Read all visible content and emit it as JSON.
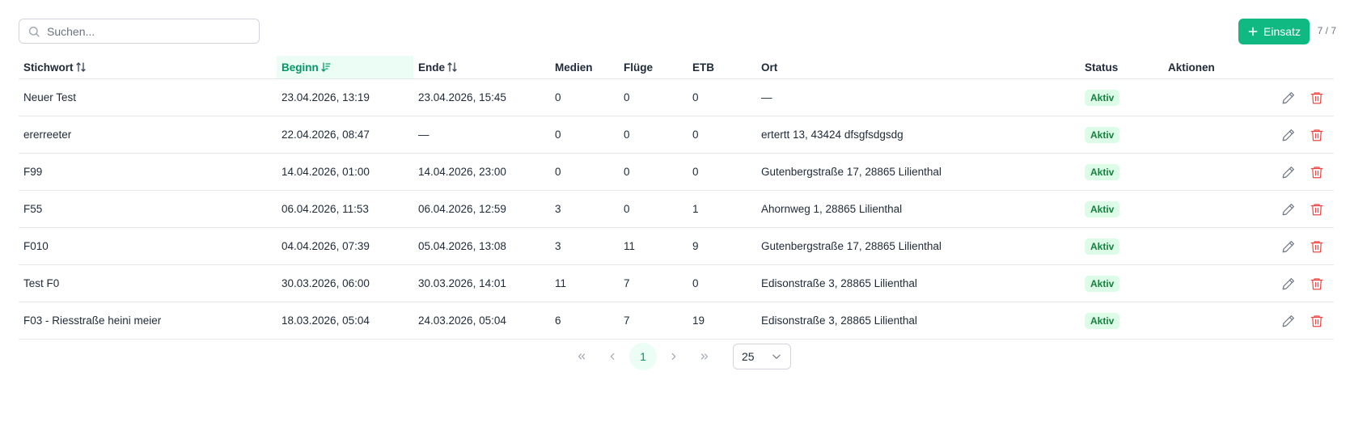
{
  "search": {
    "placeholder": "Suchen...",
    "value": ""
  },
  "toolbar": {
    "add_label": "Einsatz",
    "count": "7 / 7"
  },
  "colors": {
    "accent": "#10b981",
    "active_badge_bg": "#dcfce7",
    "active_badge_text": "#15803d",
    "delete": "#ef4444"
  },
  "table": {
    "columns": [
      {
        "label": "Stichwort",
        "sort": "unsorted"
      },
      {
        "label": "Beginn",
        "sort": "desc"
      },
      {
        "label": "Ende",
        "sort": "unsorted"
      },
      {
        "label": "Medien"
      },
      {
        "label": "Flüge"
      },
      {
        "label": "ETB"
      },
      {
        "label": "Ort"
      },
      {
        "label": "Status"
      },
      {
        "label": "Aktionen"
      }
    ],
    "rows": [
      {
        "stichwort": "Neuer Test",
        "beginn": "23.04.2026, 13:19",
        "ende": "23.04.2026, 15:45",
        "medien": "0",
        "fluege": "0",
        "etb": "0",
        "ort": "—",
        "status": "Aktiv"
      },
      {
        "stichwort": "ererreeter",
        "beginn": "22.04.2026, 08:47",
        "ende": "—",
        "medien": "0",
        "fluege": "0",
        "etb": "0",
        "ort": "ertertt 13, 43424 dfsgfsdgsdg",
        "status": "Aktiv"
      },
      {
        "stichwort": "F99",
        "beginn": "14.04.2026, 01:00",
        "ende": "14.04.2026, 23:00",
        "medien": "0",
        "fluege": "0",
        "etb": "0",
        "ort": "Gutenbergstraße 17, 28865 Lilienthal",
        "status": "Aktiv"
      },
      {
        "stichwort": "F55",
        "beginn": "06.04.2026, 11:53",
        "ende": "06.04.2026, 12:59",
        "medien": "3",
        "fluege": "0",
        "etb": "1",
        "ort": "Ahornweg 1, 28865 Lilienthal",
        "status": "Aktiv"
      },
      {
        "stichwort": "F010",
        "beginn": "04.04.2026, 07:39",
        "ende": "05.04.2026, 13:08",
        "medien": "3",
        "fluege": "11",
        "etb": "9",
        "ort": "Gutenbergstraße 17, 28865 Lilienthal",
        "status": "Aktiv"
      },
      {
        "stichwort": "Test F0",
        "beginn": "30.03.2026, 06:00",
        "ende": "30.03.2026, 14:01",
        "medien": "11",
        "fluege": "7",
        "etb": "0",
        "ort": "Edisonstraße 3, 28865 Lilienthal",
        "status": "Aktiv"
      },
      {
        "stichwort": "F03 - Riesstraße heini meier",
        "beginn": "18.03.2026, 05:04",
        "ende": "24.03.2026, 05:04",
        "medien": "6",
        "fluege": "7",
        "etb": "19",
        "ort": "Edisonstraße 3, 28865 Lilienthal",
        "status": "Aktiv"
      }
    ]
  },
  "pagination": {
    "current_page": "1",
    "page_size": "25"
  },
  "icons": {
    "search": "search-icon",
    "add": "plus-icon",
    "edit": "pencil-icon",
    "delete": "trash-icon"
  }
}
